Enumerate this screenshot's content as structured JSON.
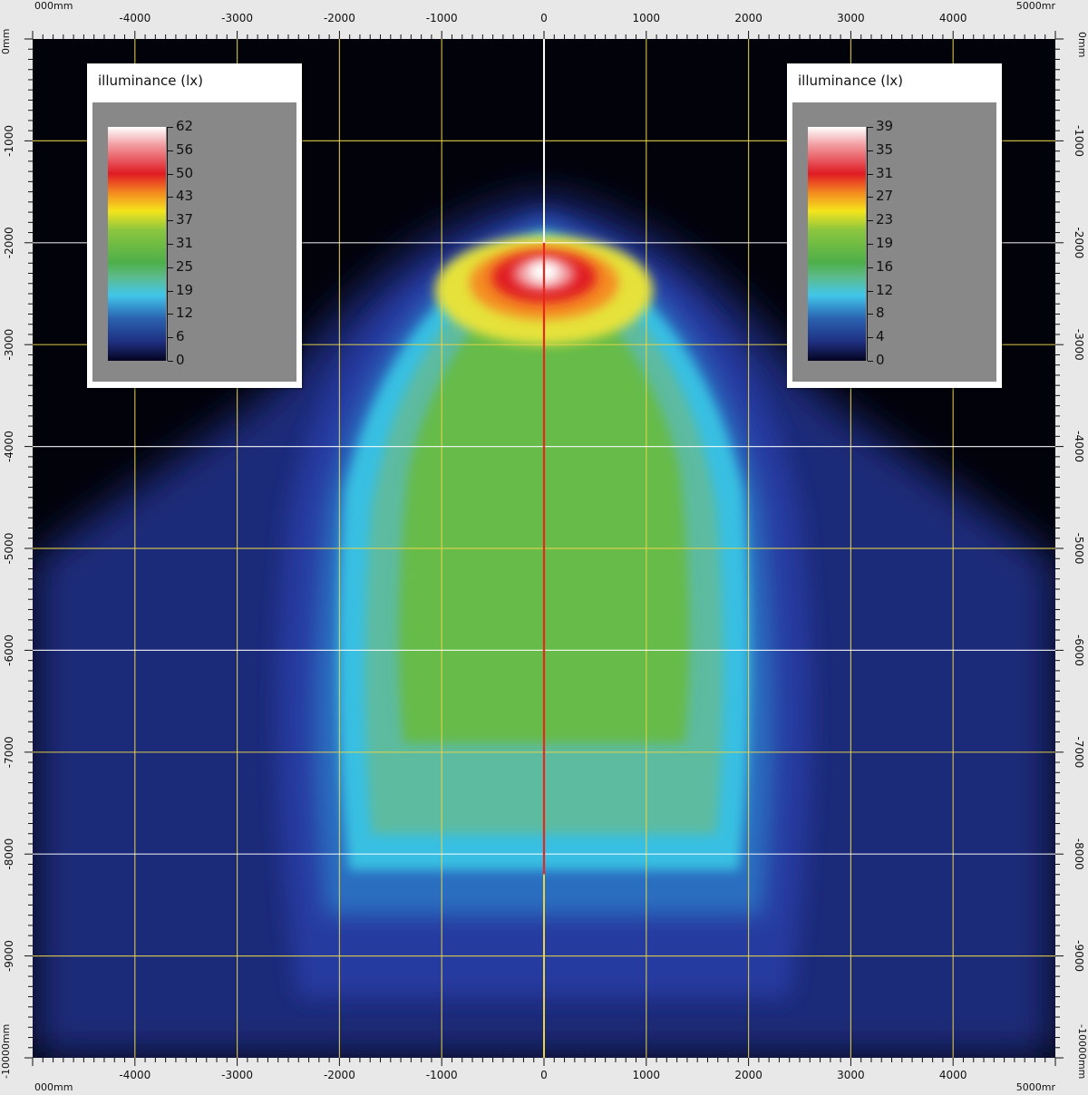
{
  "chart_data": {
    "type": "heatmap",
    "unit": "mm",
    "x_ticks": [
      "-4000",
      "-3000",
      "-2000",
      "-1000",
      "0",
      "1000",
      "2000",
      "3000",
      "4000"
    ],
    "y_ticks": [
      "-1000",
      "-2000",
      "-3000",
      "-4000",
      "-5000",
      "-6000",
      "-7000",
      "-8000",
      "-9000"
    ],
    "xlim": [
      -5000,
      5000
    ],
    "ylim": [
      -10000,
      0
    ],
    "corner_labels": {
      "top_left": "000mm",
      "top_right": "5000mr",
      "bottom_left": "000mm",
      "bottom_right": "5000mr",
      "left_top": "0mm",
      "left_bottom": "-10000mm",
      "right_top": "0mm",
      "right_bottom": "-10000mm"
    },
    "grid": true,
    "legends": [
      {
        "title": "illuminance (lx)",
        "placement": "top-left",
        "values": [
          "62",
          "56",
          "50",
          "43",
          "37",
          "31",
          "25",
          "19",
          "12",
          "6",
          "0"
        ]
      },
      {
        "title": "illuminance (lx)",
        "placement": "top-right",
        "values": [
          "39",
          "35",
          "31",
          "27",
          "23",
          "19",
          "16",
          "12",
          "8",
          "4",
          "0"
        ]
      }
    ],
    "peak_location_mm": [
      0,
      -2400
    ],
    "colors": {
      "background": "#02020a",
      "low": "#1e2a78",
      "cyan": "#41c6ea",
      "green": "#66bb4a",
      "yellow": "#f5e51c",
      "red": "#e01b24",
      "peak": "#ffffff",
      "grid_yellow": "#e8d44a",
      "grid_white": "#ffffff",
      "center_red": "#e8261f"
    }
  }
}
